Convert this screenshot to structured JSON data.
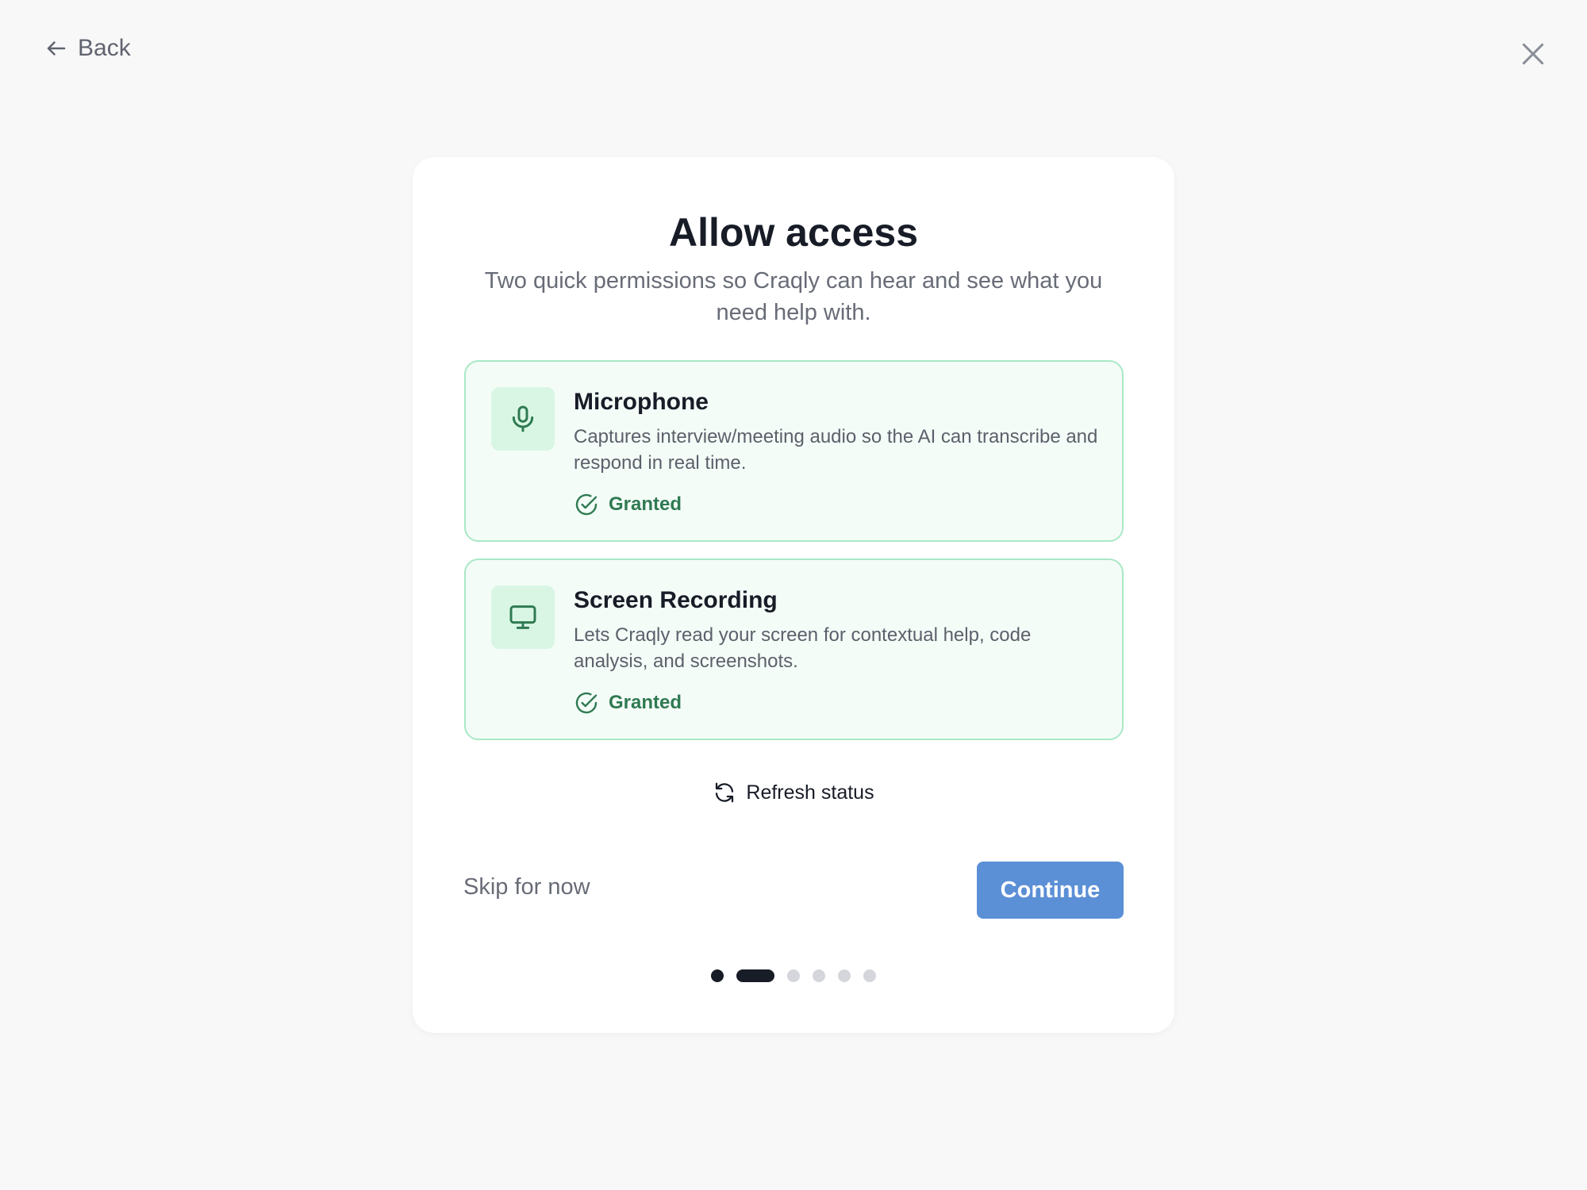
{
  "nav": {
    "back_label": "Back"
  },
  "header": {
    "title": "Allow access",
    "subtitle": "Two quick permissions so Craqly can hear and see what you need help with."
  },
  "permissions": [
    {
      "title": "Microphone",
      "description": "Captures interview/meeting audio so the AI can transcribe and respond in real time.",
      "status": "Granted",
      "icon": "microphone-icon"
    },
    {
      "title": "Screen Recording",
      "description": "Lets Craqly read your screen for contextual help, code analysis, and screenshots.",
      "status": "Granted",
      "icon": "monitor-icon"
    }
  ],
  "actions": {
    "refresh_label": "Refresh status",
    "skip_label": "Skip for now",
    "continue_label": "Continue"
  },
  "progress": {
    "total_steps": 6,
    "current_step": 2
  },
  "colors": {
    "accent": "#5b8fd6",
    "granted": "#2f7a52",
    "card_border": "#a9e8c6",
    "card_bg": "#f4fcf7"
  }
}
